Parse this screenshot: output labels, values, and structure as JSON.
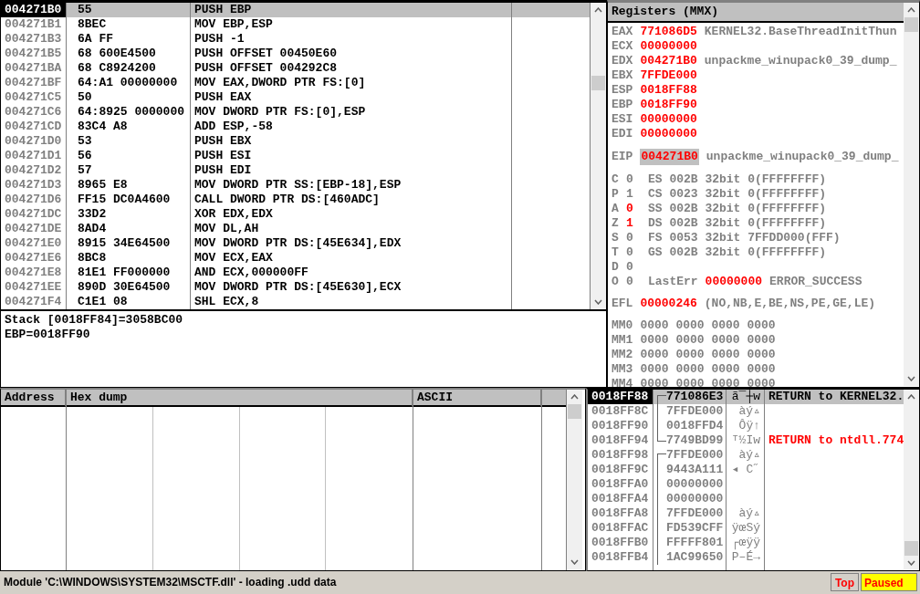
{
  "disassembly": {
    "rows": [
      {
        "address": "004271B0",
        "hex": "55",
        "command": "PUSH EBP",
        "selected": true
      },
      {
        "address": "004271B1",
        "hex": "8BEC",
        "command": "MOV EBP,ESP",
        "selected": false
      },
      {
        "address": "004271B3",
        "hex": "6A FF",
        "command": "PUSH -1",
        "selected": false
      },
      {
        "address": "004271B5",
        "hex": "68 600E4500",
        "command": "PUSH OFFSET 00450E60",
        "selected": false
      },
      {
        "address": "004271BA",
        "hex": "68 C8924200",
        "command": "PUSH OFFSET 004292C8",
        "selected": false
      },
      {
        "address": "004271BF",
        "hex": "64:A1 00000000",
        "command": "MOV EAX,DWORD PTR FS:[0]",
        "selected": false
      },
      {
        "address": "004271C5",
        "hex": "50",
        "command": "PUSH EAX",
        "selected": false
      },
      {
        "address": "004271C6",
        "hex": "64:8925 0000000",
        "command": "MOV DWORD PTR FS:[0],ESP",
        "selected": false
      },
      {
        "address": "004271CD",
        "hex": "83C4 A8",
        "command": "ADD ESP,-58",
        "selected": false
      },
      {
        "address": "004271D0",
        "hex": "53",
        "command": "PUSH EBX",
        "selected": false
      },
      {
        "address": "004271D1",
        "hex": "56",
        "command": "PUSH ESI",
        "selected": false
      },
      {
        "address": "004271D2",
        "hex": "57",
        "command": "PUSH EDI",
        "selected": false
      },
      {
        "address": "004271D3",
        "hex": "8965 E8",
        "command": "MOV DWORD PTR SS:[EBP-18],ESP",
        "selected": false
      },
      {
        "address": "004271D6",
        "hex": "FF15 DC0A4600",
        "command": "CALL DWORD PTR DS:[460ADC]",
        "selected": false
      },
      {
        "address": "004271DC",
        "hex": "33D2",
        "command": "XOR EDX,EDX",
        "selected": false
      },
      {
        "address": "004271DE",
        "hex": "8AD4",
        "command": "MOV DL,AH",
        "selected": false
      },
      {
        "address": "004271E0",
        "hex": "8915 34E64500",
        "command": "MOV DWORD PTR DS:[45E634],EDX",
        "selected": false
      },
      {
        "address": "004271E6",
        "hex": "8BC8",
        "command": "MOV ECX,EAX",
        "selected": false
      },
      {
        "address": "004271E8",
        "hex": "81E1 FF000000",
        "command": "AND ECX,000000FF",
        "selected": false
      },
      {
        "address": "004271EE",
        "hex": "890D 30E64500",
        "command": "MOV DWORD PTR DS:[45E630],ECX",
        "selected": false
      },
      {
        "address": "004271F4",
        "hex": "C1E1 08",
        "command": "SHL ECX,8",
        "selected": false
      }
    ]
  },
  "info": {
    "lines": [
      "Stack [0018FF84]=3058BC00",
      "EBP=0018FF90"
    ]
  },
  "registers": {
    "title": "Registers (MMX)",
    "rows": [
      {
        "kind": "reg",
        "name": "EAX",
        "value": "771086D5",
        "changed": true,
        "comment": "KERNEL32.BaseThreadInitThun"
      },
      {
        "kind": "reg",
        "name": "ECX",
        "value": "00000000",
        "changed": true
      },
      {
        "kind": "reg",
        "name": "EDX",
        "value": "004271B0",
        "changed": true,
        "comment": "unpackme_winupack0_39_dump_"
      },
      {
        "kind": "reg",
        "name": "EBX",
        "value": "7FFDE000",
        "changed": true
      },
      {
        "kind": "reg",
        "name": "ESP",
        "value": "0018FF88",
        "changed": true
      },
      {
        "kind": "reg",
        "name": "EBP",
        "value": "0018FF90",
        "changed": true
      },
      {
        "kind": "reg",
        "name": "ESI",
        "value": "00000000",
        "changed": true
      },
      {
        "kind": "reg",
        "name": "EDI",
        "value": "00000000",
        "changed": true
      },
      {
        "kind": "gap"
      },
      {
        "kind": "eip",
        "name": "EIP",
        "value": "004271B0",
        "changed": true,
        "selected": true,
        "comment": "unpackme_winupack0_39_dump_"
      },
      {
        "kind": "gap"
      },
      {
        "kind": "flag",
        "name": "C",
        "value": "0",
        "changed": false,
        "comment": "ES 002B 32bit 0(FFFFFFFF)"
      },
      {
        "kind": "flag",
        "name": "P",
        "value": "1",
        "changed": false,
        "comment": "CS 0023 32bit 0(FFFFFFFF)"
      },
      {
        "kind": "flag",
        "name": "A",
        "value": "0",
        "changed": true,
        "comment": "SS 002B 32bit 0(FFFFFFFF)"
      },
      {
        "kind": "flag",
        "name": "Z",
        "value": "1",
        "changed": true,
        "comment": "DS 002B 32bit 0(FFFFFFFF)"
      },
      {
        "kind": "flag",
        "name": "S",
        "value": "0",
        "changed": false,
        "comment": "FS 0053 32bit 7FFDD000(FFF)"
      },
      {
        "kind": "flag",
        "name": "T",
        "value": "0",
        "changed": false,
        "comment": "GS 002B 32bit 0(FFFFFFFF)"
      },
      {
        "kind": "flag",
        "name": "D",
        "value": "0",
        "changed": false
      },
      {
        "kind": "lasterr",
        "name": "O",
        "value": "0",
        "changed": false,
        "label": "LastErr",
        "code": "00000000",
        "comment": "ERROR_SUCCESS"
      },
      {
        "kind": "gap"
      },
      {
        "kind": "reg",
        "name": "EFL",
        "value": "00000246",
        "changed": true,
        "comment": "(NO,NB,E,BE,NS,PE,GE,LE)"
      },
      {
        "kind": "gap"
      },
      {
        "kind": "reg",
        "name": "MM0",
        "value": "0000 0000 0000 0000",
        "changed": false
      },
      {
        "kind": "reg",
        "name": "MM1",
        "value": "0000 0000 0000 0000",
        "changed": false
      },
      {
        "kind": "reg",
        "name": "MM2",
        "value": "0000 0000 0000 0000",
        "changed": false
      },
      {
        "kind": "reg",
        "name": "MM3",
        "value": "0000 0000 0000 0000",
        "changed": false
      },
      {
        "kind": "reg",
        "name": "MM4",
        "value": "0000 0000 0000 0000",
        "changed": false
      }
    ]
  },
  "dump": {
    "columns": [
      "Address",
      "Hex dump",
      "ASCII"
    ]
  },
  "stack": {
    "rows": [
      {
        "address": "0018FF88",
        "value": "771086E3",
        "ascii": "ã¯┼w",
        "comment": "RETURN to KERNEL32.",
        "frame_start": true,
        "frame_end": false,
        "selected": true
      },
      {
        "address": "0018FF8C",
        "value": "7FFDE000",
        "ascii": "àý▵",
        "frame_start": false,
        "frame_end": false,
        "selected": false
      },
      {
        "address": "0018FF90",
        "value": "0018FFD4",
        "ascii": "Ôÿ↑",
        "frame_start": false,
        "frame_end": false,
        "selected": false
      },
      {
        "address": "0018FF94",
        "value": "7749BD99",
        "ascii": "ᵀ½Iw",
        "comment": "RETURN to ntdll.774",
        "frame_start": false,
        "frame_end": true,
        "selected": false
      },
      {
        "address": "0018FF98",
        "value": "7FFDE000",
        "ascii": "àý▵",
        "frame_start": true,
        "frame_end": false,
        "selected": false
      },
      {
        "address": "0018FF9C",
        "value": "9443A111",
        "ascii": "◂ C˝",
        "frame_start": false,
        "frame_end": false,
        "selected": false
      },
      {
        "address": "0018FFA0",
        "value": "00000000",
        "frame_start": false,
        "frame_end": false,
        "selected": false
      },
      {
        "address": "0018FFA4",
        "value": "00000000",
        "frame_start": false,
        "frame_end": false,
        "selected": false
      },
      {
        "address": "0018FFA8",
        "value": "7FFDE000",
        "ascii": "àý▵",
        "frame_start": false,
        "frame_end": false,
        "selected": false
      },
      {
        "address": "0018FFAC",
        "value": "FD539CFF",
        "ascii": "ÿœSý",
        "frame_start": false,
        "frame_end": false,
        "selected": false
      },
      {
        "address": "0018FFB0",
        "value": "FFFFF801",
        "ascii": "┌œÿÿ",
        "frame_start": false,
        "frame_end": false,
        "selected": false
      },
      {
        "address": "0018FFB4",
        "value": "1AC99650",
        "ascii": "P–É→",
        "frame_start": false,
        "frame_end": false,
        "selected": false
      }
    ]
  },
  "status_bar": {
    "message": "Module 'C:\\WINDOWS\\SYSTEM32\\MSCTF.dll' - loading .udd data",
    "position": "Top",
    "state": "Paused"
  }
}
